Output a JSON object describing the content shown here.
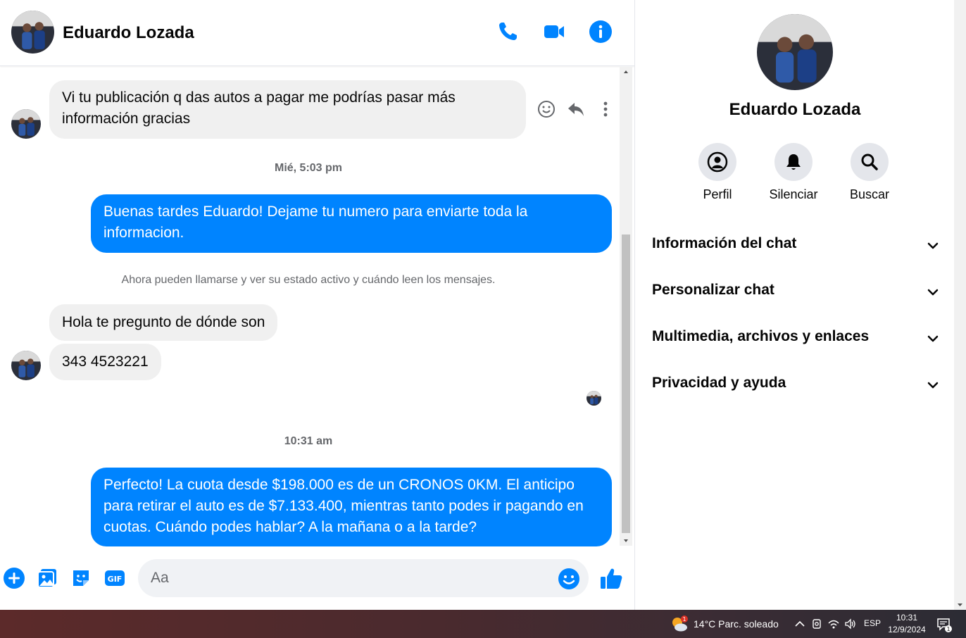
{
  "contact": {
    "name": "Eduardo Lozada"
  },
  "messages": [
    {
      "id": "m1",
      "direction": "in",
      "text": "Vi tu publicación q das autos a pagar me podrías pasar más información gracias"
    },
    {
      "id": "m2",
      "direction": "out",
      "text": "Buenas tardes Eduardo! Dejame tu numero para enviarte toda la informacion."
    },
    {
      "id": "m3",
      "direction": "in",
      "text": "Hola te pregunto de dónde son"
    },
    {
      "id": "m4",
      "direction": "in",
      "text": "343 4523221"
    },
    {
      "id": "m5",
      "direction": "out",
      "text": "Perfecto! La cuota desde $198.000 es de un CRONOS 0KM. El anticipo para retirar el auto es de $7.133.400, mientras tanto podes ir pagando en cuotas. Cuándo podes hablar? A la mañana o a la tarde?"
    }
  ],
  "timestamps": {
    "t1": "Mié, 5:03 pm",
    "t2": "10:31 am"
  },
  "notice": "Ahora pueden llamarse y ver su estado activo y cuándo leen los mensajes.",
  "composer": {
    "placeholder": "Aa"
  },
  "side_panel": {
    "actions": [
      "Perfil",
      "Silenciar",
      "Buscar"
    ],
    "sections": [
      "Información del chat",
      "Personalizar chat",
      "Multimedia, archivos y enlaces",
      "Privacidad y ayuda"
    ]
  },
  "taskbar": {
    "weather": "14°C  Parc. soleado",
    "weather_badge": "1",
    "language": "ESP",
    "time": "10:31",
    "date": "12/9/2024",
    "notifications": "1"
  },
  "colors": {
    "accent": "#0084ff",
    "incoming_bubble": "#f0f0f0",
    "muted_text": "#65676b"
  }
}
